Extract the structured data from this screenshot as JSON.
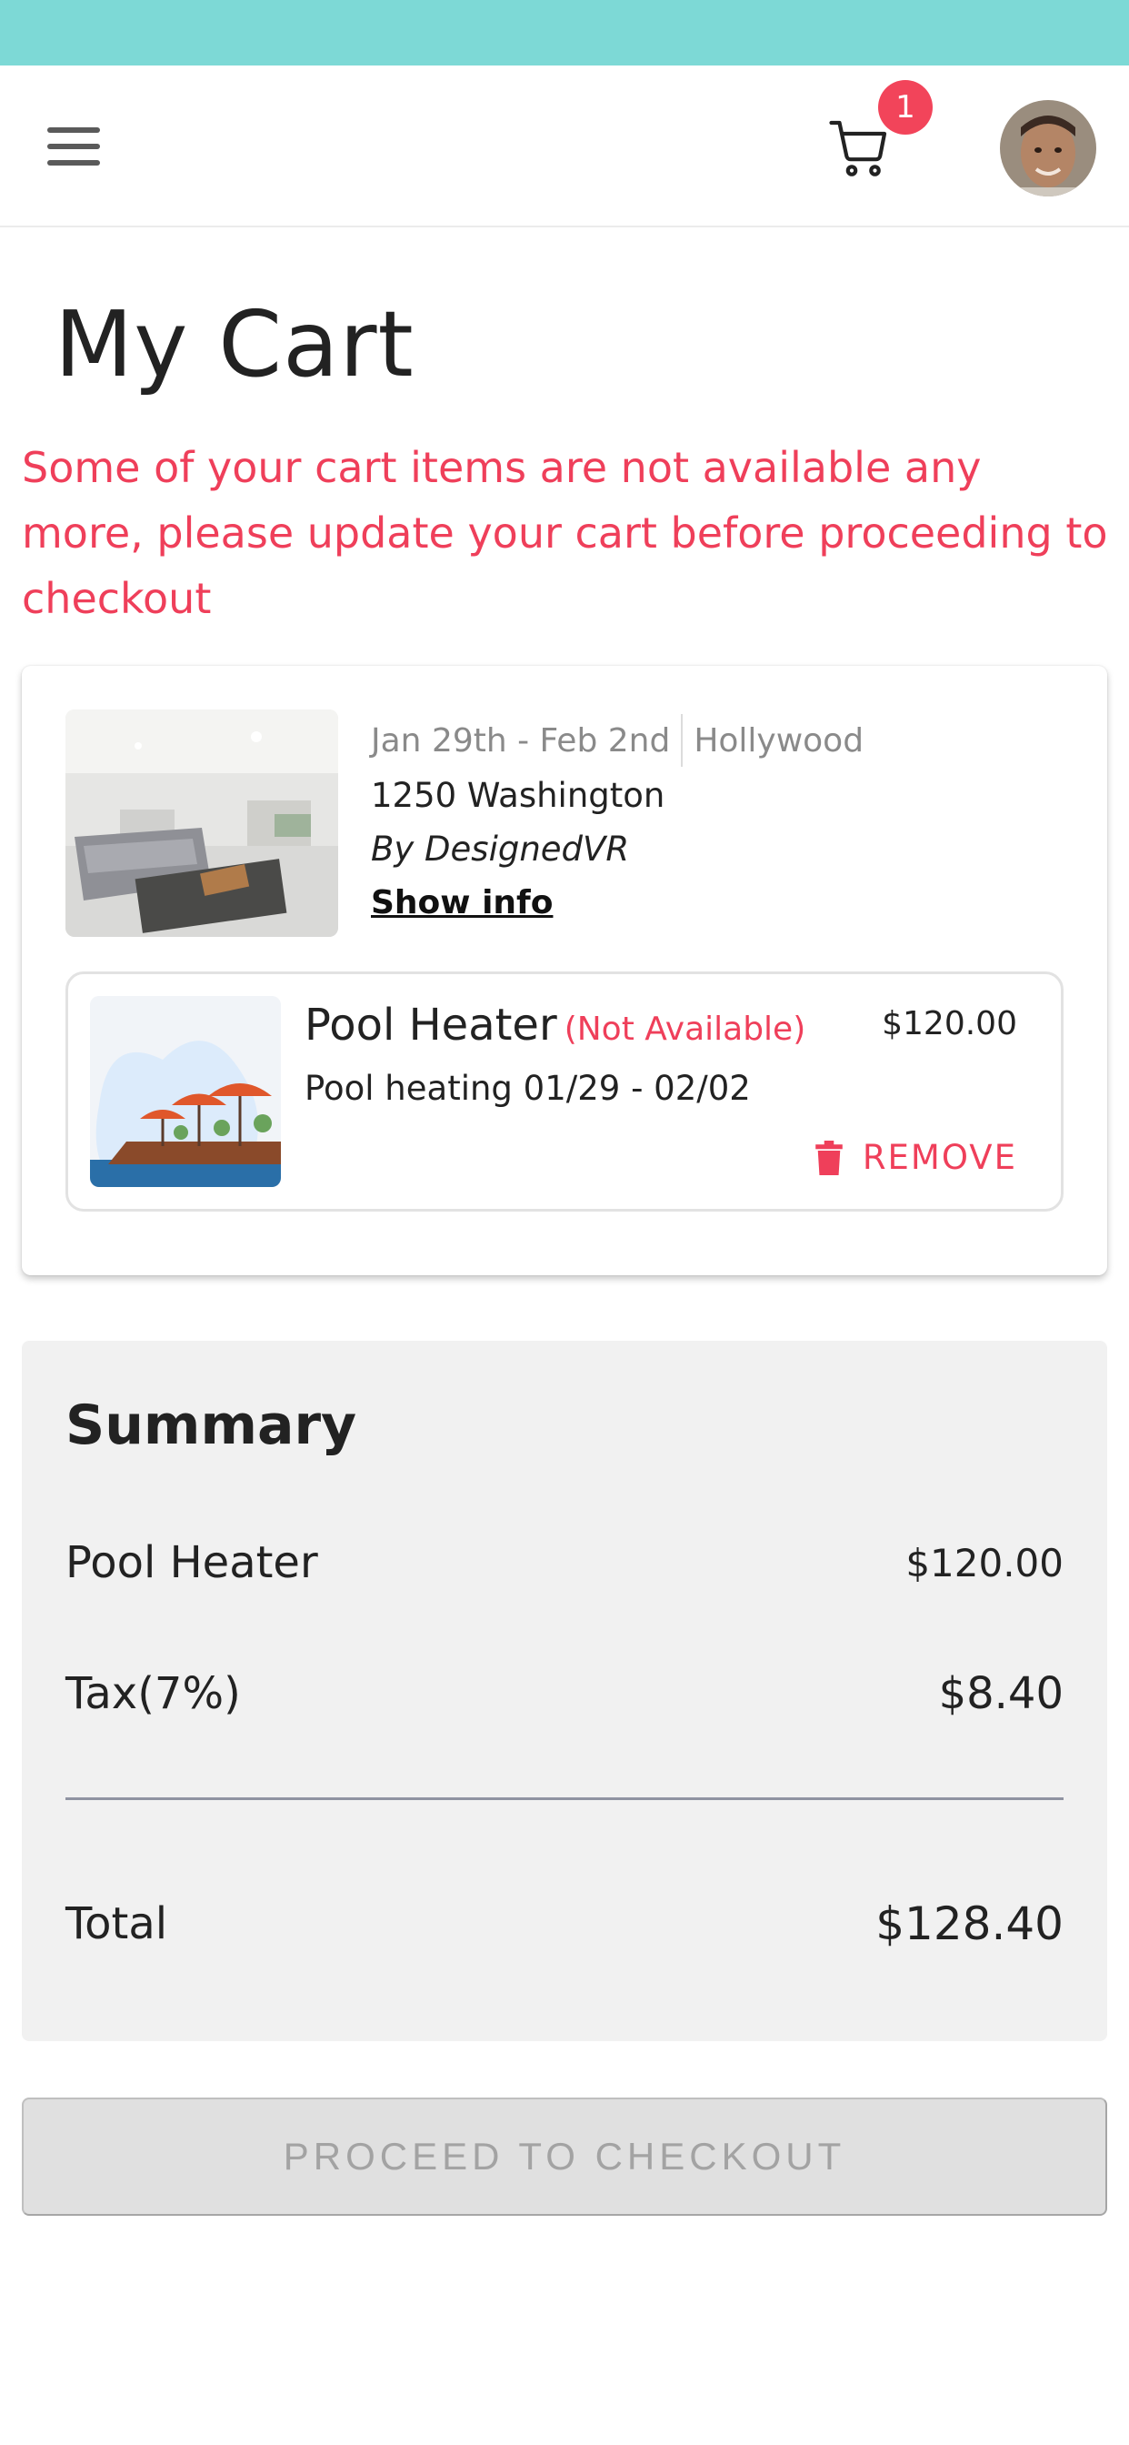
{
  "header": {
    "cart_count": "1",
    "menu_icon": "hamburger-menu-icon",
    "cart_icon": "shopping-cart-icon",
    "avatar": "user-avatar"
  },
  "page": {
    "title": "My Cart",
    "warning": "Some of your cart items are not available any more, please update your cart before proceeding to checkout"
  },
  "booking": {
    "dates": "Jan 29th - Feb 2nd",
    "location": "Hollywood",
    "address": "1250 Washington",
    "host": "By DesignedVR",
    "show_info_label": "Show info",
    "addon": {
      "title": "Pool Heater",
      "availability": "(Not Available)",
      "price": "$120.00",
      "description": "Pool heating 01/29 - 02/02",
      "remove_label": "REMOVE"
    }
  },
  "summary": {
    "title": "Summary",
    "item_label": "Pool Heater",
    "item_value": "$120.00",
    "tax_label": "Tax(7%)",
    "tax_value": "$8.40",
    "total_label": "Total",
    "total_value": "$128.40"
  },
  "checkout": {
    "label": "PROCEED TO CHECKOUT"
  },
  "colors": {
    "status_bar": "#7dd9d6",
    "error": "#ef3f5a",
    "badge": "#f2445a"
  }
}
